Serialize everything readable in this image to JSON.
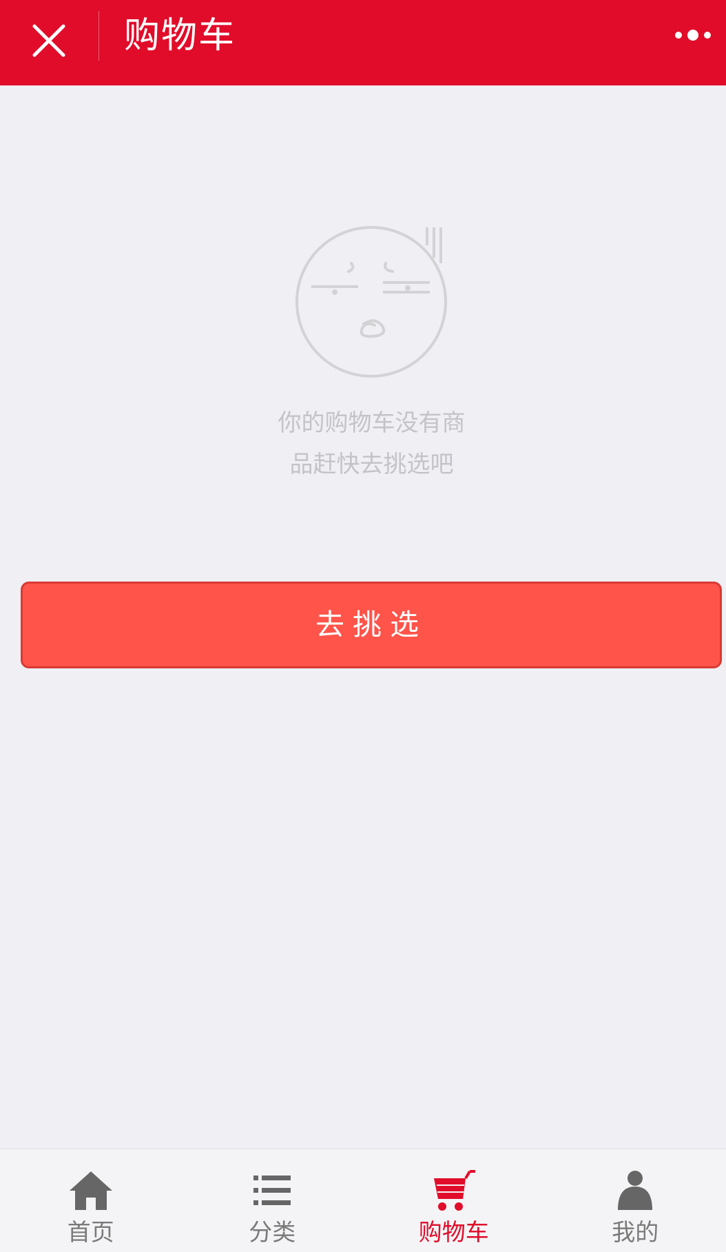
{
  "header": {
    "title": "购物车",
    "background_color": "#e10c2a",
    "close_icon": "close-icon",
    "more_icon": "more-dots-icon"
  },
  "empty_state": {
    "icon": "sad-face-icon",
    "message_line1": "你的购物车没有商",
    "message_line2": "品赶快去挑选吧"
  },
  "actions": {
    "go_shopping_label": "去挑选",
    "button_color": "#ff544a"
  },
  "tabbar": {
    "active_color": "#e10c2a",
    "items": [
      {
        "label": "首页",
        "icon": "home-icon",
        "active": false
      },
      {
        "label": "分类",
        "icon": "list-icon",
        "active": false
      },
      {
        "label": "购物车",
        "icon": "cart-icon",
        "active": true
      },
      {
        "label": "我的",
        "icon": "user-icon",
        "active": false
      }
    ]
  }
}
